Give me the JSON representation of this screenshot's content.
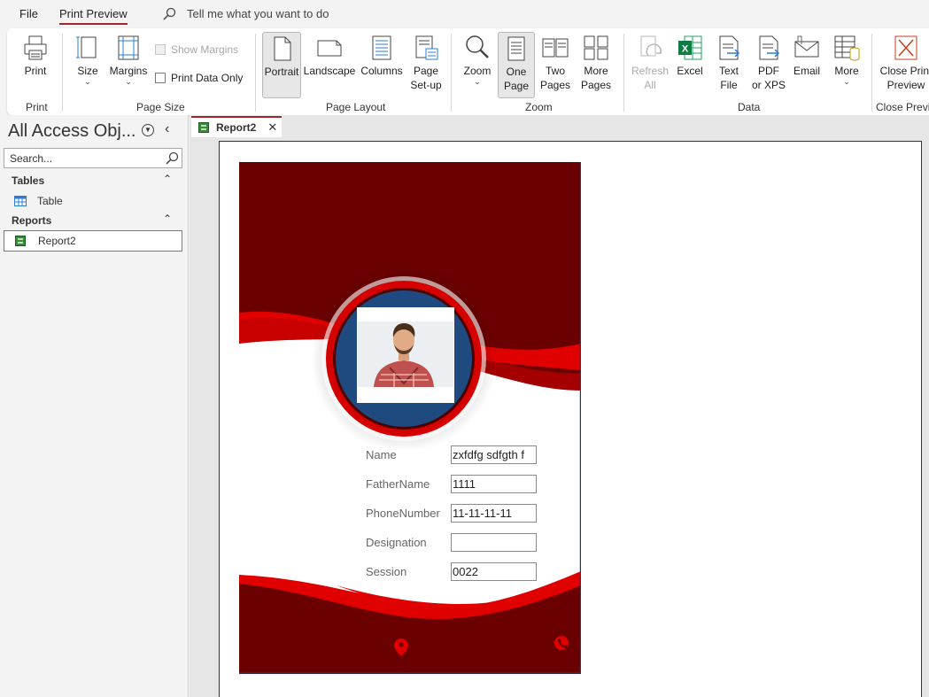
{
  "menu": {
    "file": "File",
    "print_preview": "Print Preview",
    "tell_me": "Tell me what you want to do"
  },
  "ribbon": {
    "print_group": {
      "print": "Print",
      "label": "Print"
    },
    "page_size_group": {
      "size": "Size",
      "margins": "Margins",
      "show_margins": "Show Margins",
      "print_data_only": "Print Data Only",
      "label": "Page Size"
    },
    "page_layout_group": {
      "portrait": "Portrait",
      "landscape": "Landscape",
      "columns": "Columns",
      "page_setup_1": "Page",
      "page_setup_2": "Set-up",
      "label": "Page Layout"
    },
    "zoom_group": {
      "zoom": "Zoom",
      "one_page_1": "One",
      "one_page_2": "Page",
      "two_pages_1": "Two",
      "two_pages_2": "Pages",
      "more_pages_1": "More",
      "more_pages_2": "Pages",
      "label": "Zoom"
    },
    "data_group": {
      "refresh_1": "Refresh",
      "refresh_2": "All",
      "excel": "Excel",
      "text_file_1": "Text",
      "text_file_2": "File",
      "pdf_1": "PDF",
      "pdf_2": "or XPS",
      "email": "Email",
      "more": "More",
      "label": "Data"
    },
    "close_group": {
      "close_1": "Close Print",
      "close_2": "Preview",
      "label": "Close Preview"
    }
  },
  "nav": {
    "title": "All Access Obj...",
    "search_placeholder": "Search...",
    "sections": [
      {
        "title": "Tables",
        "items": [
          "Table"
        ]
      },
      {
        "title": "Reports",
        "items": [
          "Report2"
        ]
      }
    ]
  },
  "document": {
    "tab_label": "Report2",
    "fields": [
      {
        "label": "Name",
        "value": "zxfdfg  sdfgth f"
      },
      {
        "label": "FatherName",
        "value": "1111"
      },
      {
        "label": "PhoneNumber",
        "value": "11-11-11-11"
      },
      {
        "label": "Designation",
        "value": ""
      },
      {
        "label": "Session",
        "value": "0022"
      }
    ]
  },
  "colors": {
    "accent": "#a4262c",
    "card_dark_red": "#6b0000",
    "card_red": "#e00000",
    "card_blue": "#1f4a80"
  }
}
